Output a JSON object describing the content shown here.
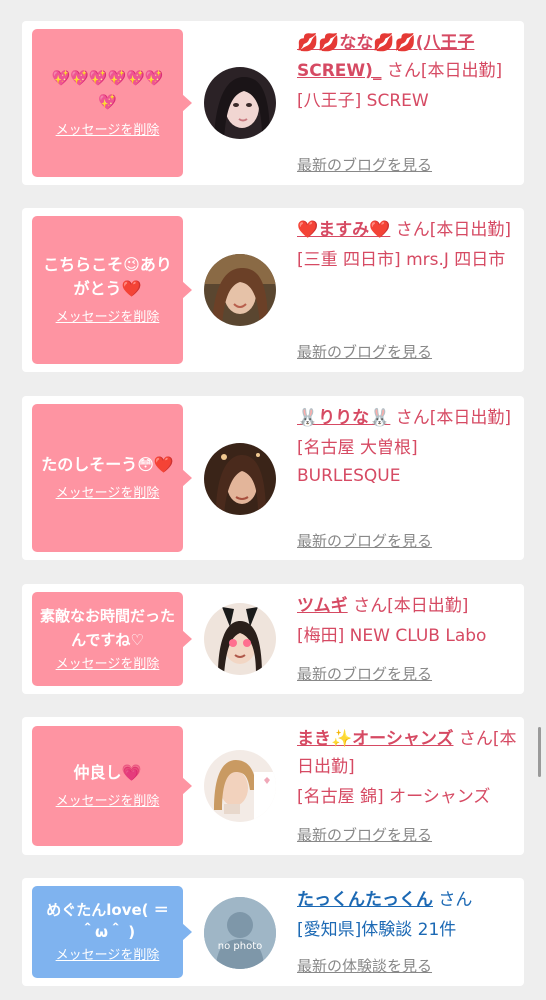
{
  "cards": [
    {
      "bubble_text": "💖💖💖💖💖💖💖",
      "delete_label": "メッセージを削除",
      "name": "💋💋なな💋💋(八王子SCREW)_",
      "suffix": "さん[本日出勤]",
      "location": "[八王子] SCREW",
      "link": "最新のブログを見る"
    },
    {
      "bubble_text": "こちらこそ😉ありがとう❤️",
      "delete_label": "メッセージを削除",
      "name": "❤️ますみ❤️",
      "suffix": "さん[本日出勤]",
      "location": "[三重 四日市] mrs.J 四日市",
      "link": "最新のブログを見る"
    },
    {
      "bubble_text": "たのしそーう😳❤️",
      "delete_label": "メッセージを削除",
      "name": "🐰りりな🐰",
      "suffix": "さん[本日出勤]",
      "location": "[名古屋 大曽根] BURLESQUE",
      "link": "最新のブログを見る"
    },
    {
      "bubble_text": "素敵なお時間だったんですね♡",
      "delete_label": "メッセージを削除",
      "name": "ツムギ",
      "suffix": "さん[本日出勤]",
      "location": "[梅田] NEW CLUB Labo",
      "link": "最新のブログを見る"
    },
    {
      "bubble_text": "仲良し💗",
      "delete_label": "メッセージを削除",
      "name": "まき✨オーシャンズ",
      "suffix": "さん[本日出勤]",
      "location": "[名古屋 錦] オーシャンズ",
      "link": "最新のブログを見る"
    },
    {
      "bubble_text": "めぐたんlove( ＝ ＾ω＾ )",
      "delete_label": "メッセージを削除",
      "name": "たっくんたっくん",
      "suffix": "さん",
      "location": "[愛知県]体験談 21件",
      "link": "最新の体験談を見る",
      "avatar_text": "no photo"
    }
  ],
  "colors": {
    "bubble_pink": "#fe94a2",
    "bubble_blue": "#7fb3ef",
    "name_pink": "#d64a63",
    "name_blue": "#1c69b4",
    "link_gray": "#888888"
  }
}
